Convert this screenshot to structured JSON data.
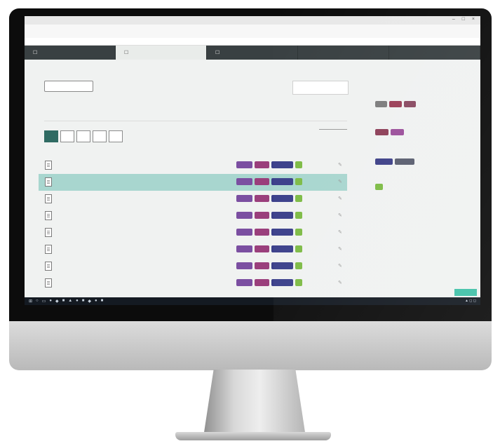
{
  "browser": {
    "tab_title": "",
    "url": "",
    "bookmarks": [
      "",
      "",
      "",
      "",
      "",
      "",
      "",
      "",
      "",
      "",
      ""
    ],
    "infobar_left": "",
    "infobar_right": ""
  },
  "nav": {
    "tabs": [
      {
        "label": "",
        "active": false
      },
      {
        "label": "",
        "active": true
      },
      {
        "label": "",
        "active": false
      },
      {
        "label": "",
        "active": false
      },
      {
        "label": "",
        "active": false
      }
    ]
  },
  "toolbar": {
    "add_label": "",
    "search_placeholder": ""
  },
  "list": {
    "section_label": "",
    "filter_label": "",
    "filter_buttons": [
      "",
      "",
      "",
      "",
      ""
    ],
    "sort_label": "",
    "rows": [
      {
        "label": "",
        "selected": false
      },
      {
        "label": "",
        "selected": true
      },
      {
        "label": "",
        "selected": false
      },
      {
        "label": "",
        "selected": false
      },
      {
        "label": "",
        "selected": false
      },
      {
        "label": "",
        "selected": false
      },
      {
        "label": "",
        "selected": false
      },
      {
        "label": "",
        "selected": false
      }
    ],
    "tag_colors": [
      "#7b4fa1",
      "#9a3f7c",
      "#3a3f8a",
      "#7dbb45"
    ]
  },
  "sidebar": {
    "note": "",
    "groups": [
      {
        "title": "",
        "chips": [
          "grey",
          "red",
          "rose"
        ]
      },
      {
        "title": "",
        "chips": [
          "maroon",
          "purple"
        ]
      },
      {
        "title": "",
        "chips": [
          "navy",
          "slate"
        ]
      },
      {
        "title": "",
        "chips": [
          "green"
        ]
      }
    ],
    "help_label": ""
  },
  "colors": {
    "nav_bg": "#394042",
    "selected_row": "#a8d6cf",
    "accent": "#40c1a8",
    "filter_active": "#2f6b63"
  },
  "icons": {
    "row": "document-icon",
    "edit": "pencil-icon",
    "nav": "square-icon"
  }
}
